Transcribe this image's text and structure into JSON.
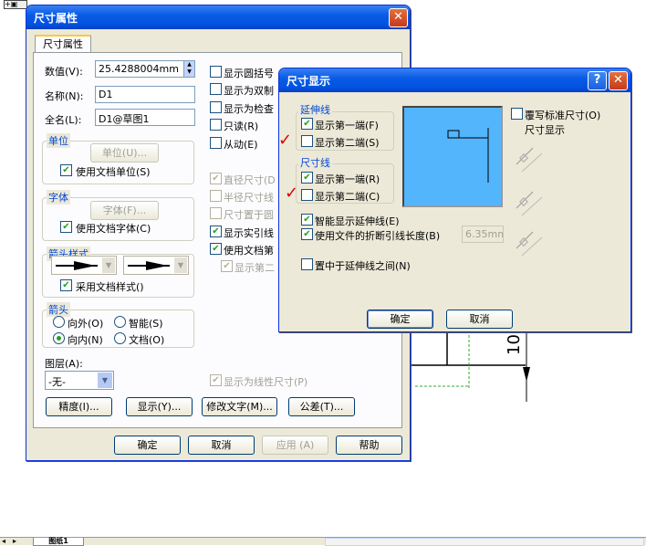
{
  "back": {
    "tab": "图纸1",
    "ruler_text": "10"
  },
  "props": {
    "title": "尺寸属性",
    "tab": "尺寸属性",
    "value_label": "数值(V):",
    "value": "25.4288004mm",
    "name_label": "名称(N):",
    "name": "D1",
    "fullname_label": "全名(L):",
    "fullname": "D1@草图1",
    "unit_group": "单位",
    "unit_btn": "单位(U)...",
    "use_doc_units": "使用文档单位(S)",
    "font_group": "字体",
    "font_btn": "字体(F)...",
    "use_doc_font": "使用文档字体(C)",
    "arrow_style_group": "箭头样式",
    "use_doc_style": "采用文档样式()",
    "arrow_group": "箭头",
    "outside": "向外(O)",
    "smart": "智能(S)",
    "inside": "向内(N)",
    "doc": "文档(O)",
    "layer_label": "图层(A):",
    "layer_value": "-无-",
    "right": {
      "show_paren": "显示圆括号",
      "show_dual": "显示为双制",
      "show_inspect": "显示为检查",
      "readonly": "只读(R)",
      "driven": "从动(E)",
      "diameter": "直径尺寸(D",
      "radius": "半径尺寸线",
      "dim_at_center": "尺寸置于圆",
      "show_leader": "显示实引线",
      "use_doc_first": "使用文档第",
      "show_second": "显示第二",
      "show_linear": "显示为线性尺寸(P)"
    },
    "precision_btn": "精度(I)...",
    "display_btn": "显示(Y)...",
    "modify_btn": "修改文字(M)...",
    "tolerance_btn": "公差(T)...",
    "ok": "确定",
    "cancel": "取消",
    "apply": "应用 (A)",
    "help": "帮助"
  },
  "dim": {
    "title": "尺寸显示",
    "help_icon": "?",
    "ext_group": "延伸线",
    "ext_first": "显示第一端(F)",
    "ext_second": "显示第二端(S)",
    "dim_group": "尺寸线",
    "dim_first": "显示第一端(R)",
    "dim_second": "显示第二端(C)",
    "smart_ext": "智能显示延伸线(E)",
    "use_break": "使用文件的折断引线长度(B)",
    "break_len": "6.35mm",
    "center": "置中于延伸线之间(N)",
    "override": "覆写标准尺寸(O)",
    "dim_display": "尺寸显示",
    "ok": "确定",
    "cancel": "取消",
    "annot_mark": "✓"
  },
  "colors": {
    "preview_bg": "#53b5fb",
    "title_blue": "#0a5ce6",
    "check_green": "#21a121",
    "annot_red": "#e00000"
  }
}
